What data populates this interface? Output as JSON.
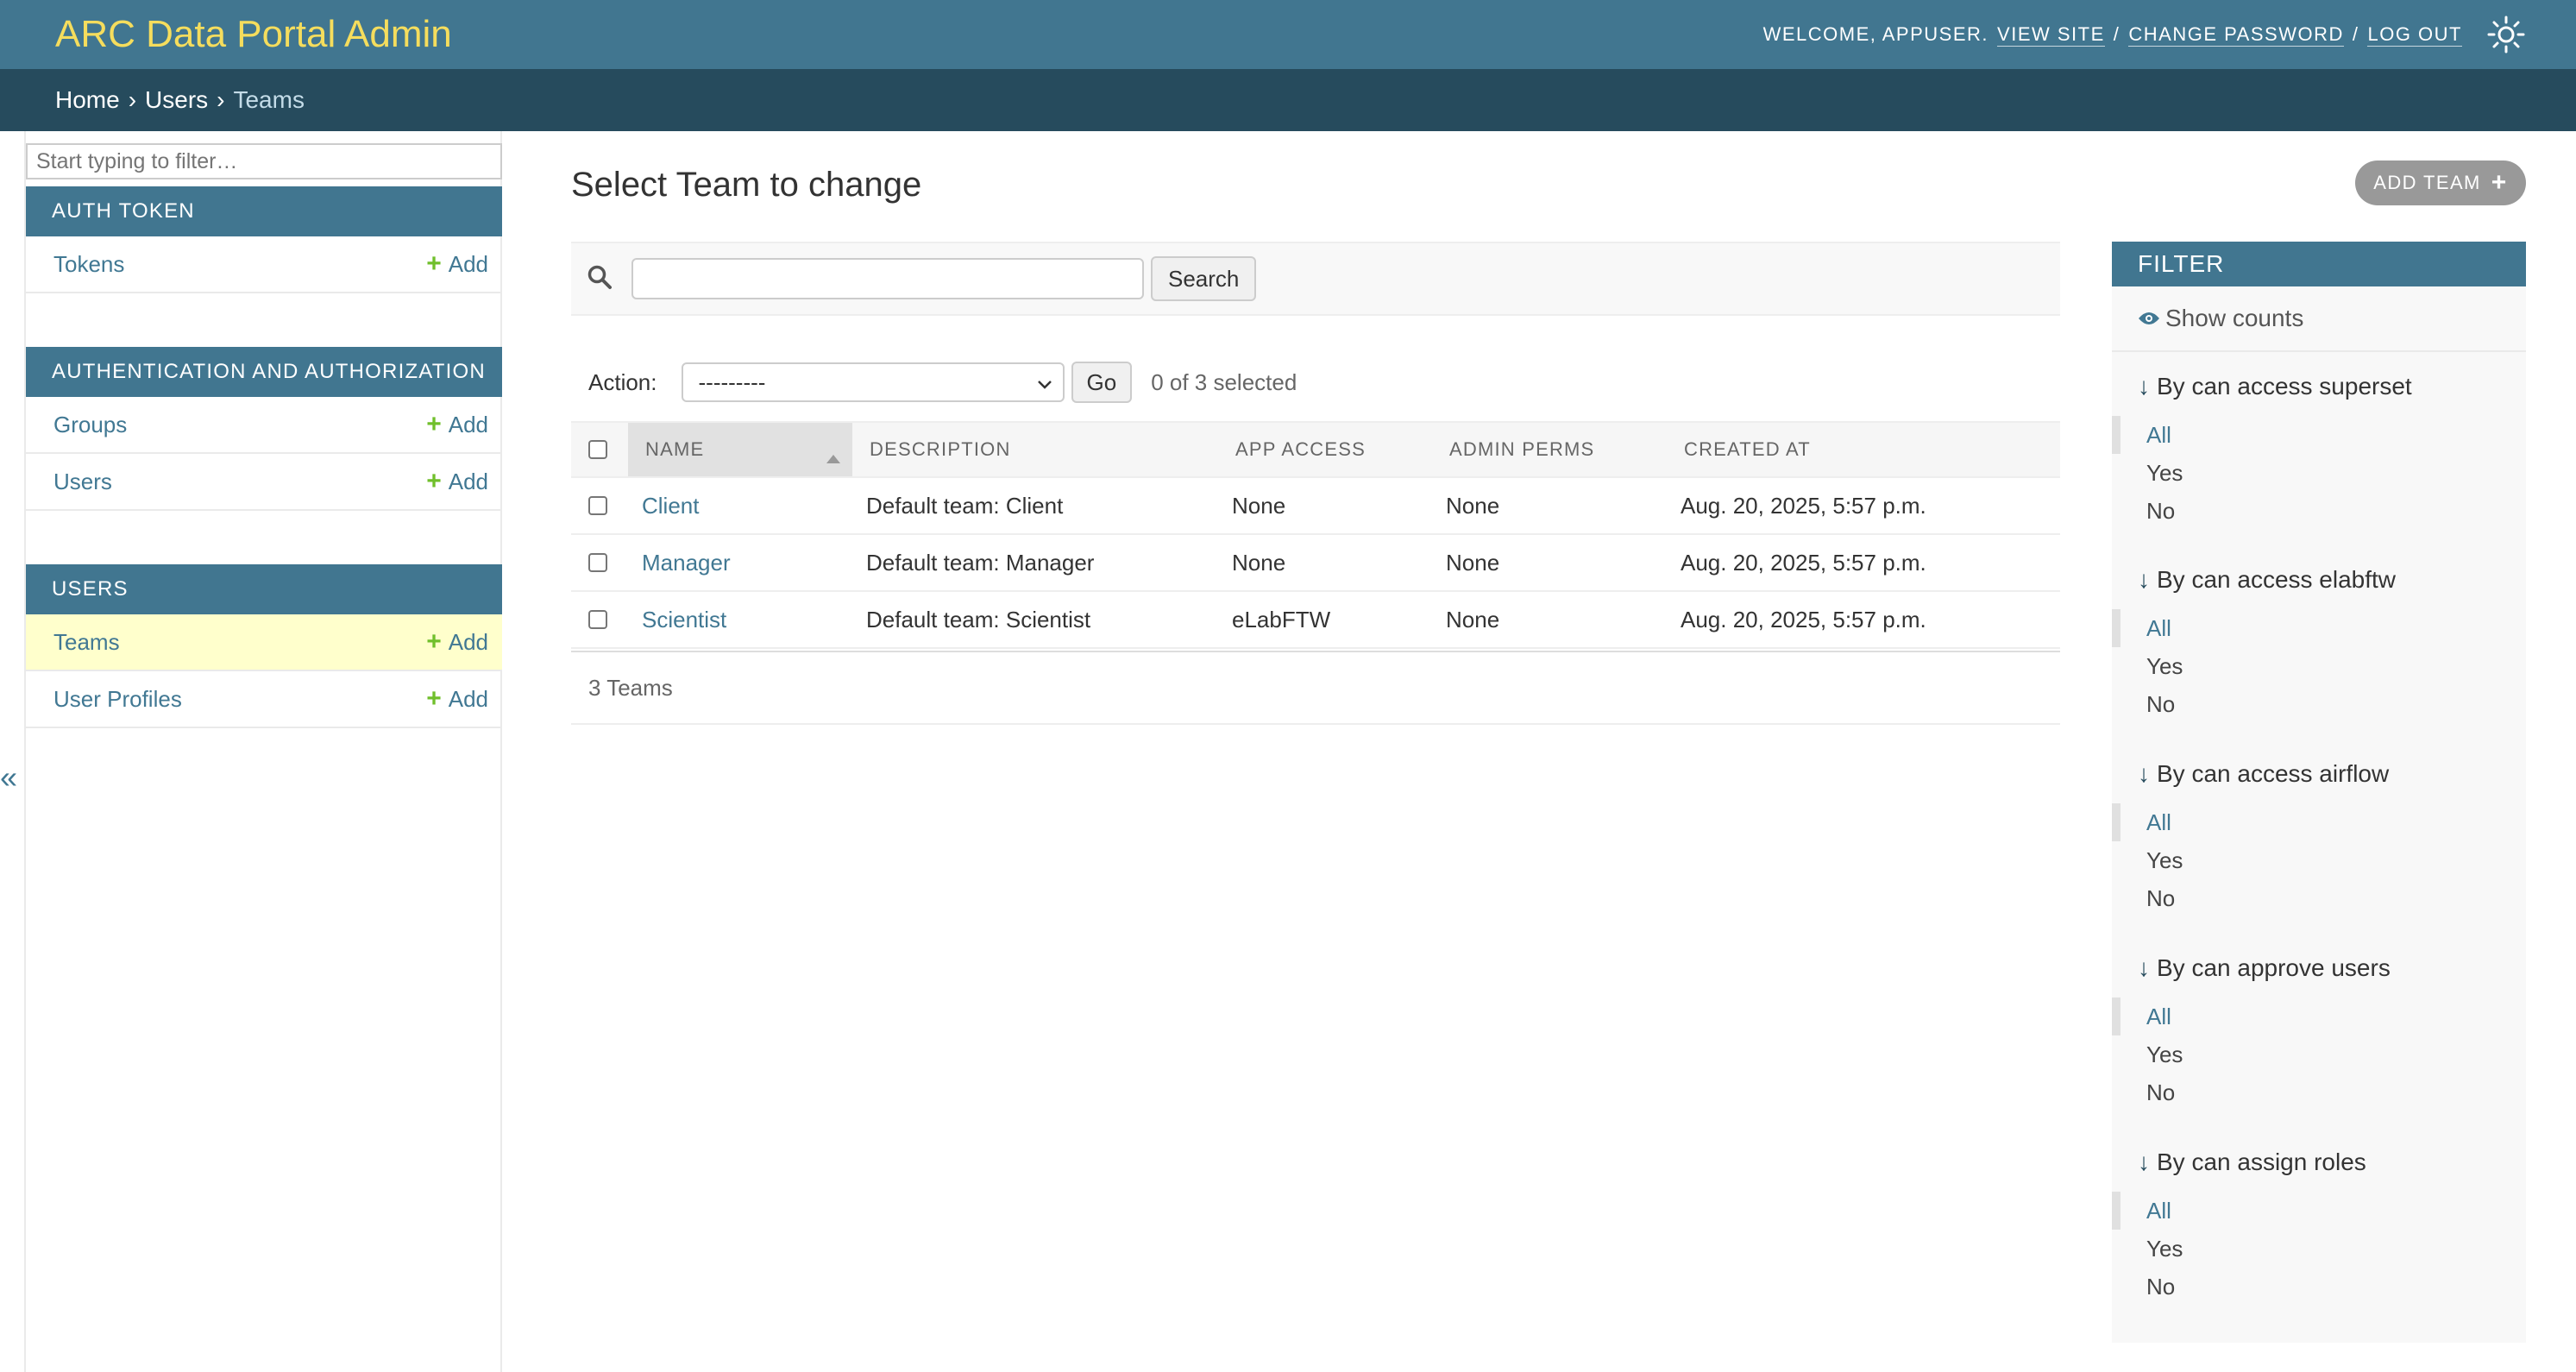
{
  "header": {
    "brand": "ARC Data Portal Admin",
    "welcome": "WELCOME, APPUSER.",
    "view_site": "VIEW SITE",
    "change_password": "CHANGE PASSWORD",
    "log_out": "LOG OUT",
    "separator": "/"
  },
  "breadcrumbs": {
    "home": "Home",
    "users": "Users",
    "current": "Teams",
    "sep": "›"
  },
  "sidebar": {
    "filter_placeholder": "Start typing to filter…",
    "collapse": "«",
    "modules": [
      {
        "title": "Auth Token",
        "models": [
          {
            "label": "Tokens",
            "add": "Add"
          }
        ]
      },
      {
        "title": "Authentication and Authorization",
        "models": [
          {
            "label": "Groups",
            "add": "Add"
          },
          {
            "label": "Users",
            "add": "Add"
          }
        ]
      },
      {
        "title": "Users",
        "models": [
          {
            "label": "Teams",
            "add": "Add"
          },
          {
            "label": "User Profiles",
            "add": "Add"
          }
        ]
      }
    ]
  },
  "main": {
    "title": "Select Team to change",
    "add_button": "ADD TEAM",
    "search_button": "Search",
    "action_label": "Action:",
    "action_selected": "---------",
    "go_button": "Go",
    "selected_count": "0 of 3 selected",
    "columns": [
      "Name",
      "Description",
      "App Access",
      "Admin Perms",
      "Created At"
    ],
    "rows": [
      {
        "name": "Client",
        "description": "Default team: Client",
        "app_access": "None",
        "admin_perms": "None",
        "created_at": "Aug. 20, 2025, 5:57 p.m."
      },
      {
        "name": "Manager",
        "description": "Default team: Manager",
        "app_access": "None",
        "admin_perms": "None",
        "created_at": "Aug. 20, 2025, 5:57 p.m."
      },
      {
        "name": "Scientist",
        "description": "Default team: Scientist",
        "app_access": "eLabFTW",
        "admin_perms": "None",
        "created_at": "Aug. 20, 2025, 5:57 p.m."
      }
    ],
    "paginator": "3 Teams"
  },
  "filter": {
    "title": "FILTER",
    "show_counts": "Show counts",
    "groups": [
      {
        "title": "By can access superset",
        "options": [
          "All",
          "Yes",
          "No"
        ]
      },
      {
        "title": "By can access elabftw",
        "options": [
          "All",
          "Yes",
          "No"
        ]
      },
      {
        "title": "By can access airflow",
        "options": [
          "All",
          "Yes",
          "No"
        ]
      },
      {
        "title": "By can approve users",
        "options": [
          "All",
          "Yes",
          "No"
        ]
      },
      {
        "title": "By can assign roles",
        "options": [
          "All",
          "Yes",
          "No"
        ]
      }
    ]
  },
  "colors": {
    "header_bg": "#417690",
    "brand": "#f5dd5d",
    "breadcrumb_bg": "#264b5d",
    "link": "#417893",
    "add_plus": "#70bf2b",
    "current_row": "#ffffcc"
  }
}
